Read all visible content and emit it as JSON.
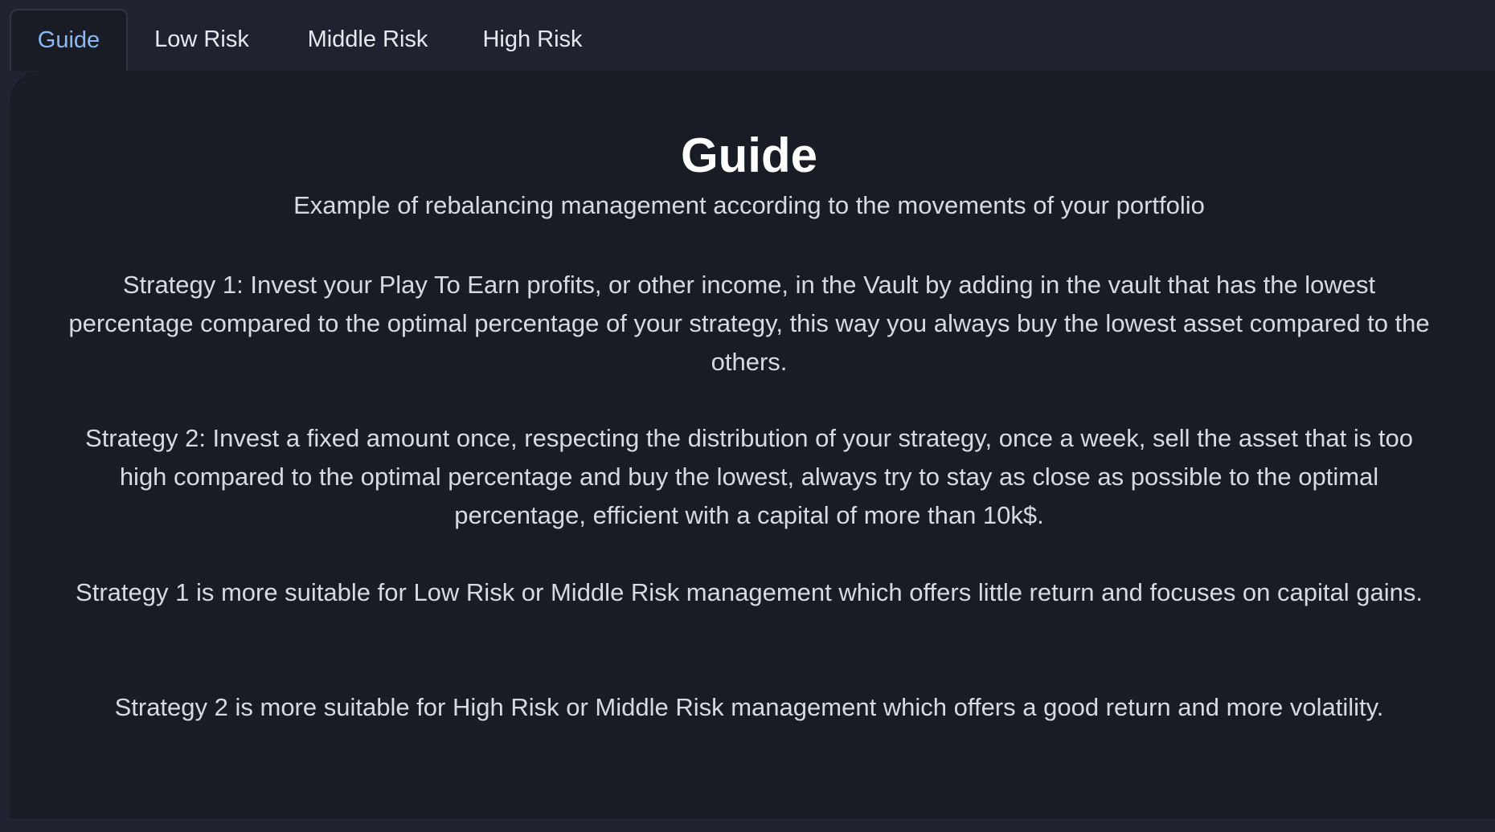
{
  "tabs": [
    {
      "label": "Guide",
      "active": true
    },
    {
      "label": "Low Risk",
      "active": false
    },
    {
      "label": "Middle Risk",
      "active": false
    },
    {
      "label": "High Risk",
      "active": false
    }
  ],
  "guide": {
    "title": "Guide",
    "subtitle": "Example of rebalancing management according to the movements of your portfolio",
    "paragraphs": [
      "Strategy 1: Invest your Play To Earn profits, or other income, in the Vault by adding in the vault that has the lowest percentage compared to the optimal percentage of your strategy, this way you always buy the lowest asset compared to the others.",
      "Strategy 2: Invest a fixed amount once, respecting the distribution of your strategy, once a week, sell the asset that is too high compared to the optimal percentage and buy the lowest, always try to stay as close as possible to the optimal percentage, efficient with a capital of more than 10k$.",
      "Strategy 1 is more suitable for Low Risk or Middle Risk management which offers little return and focuses on capital gains.",
      "Strategy 2 is more suitable for High Risk or Middle Risk management which offers a good return and more volatility."
    ]
  },
  "colors": {
    "background": "#1f2330",
    "panel": "#191c25",
    "active_tab_text": "#8ab9f5",
    "text": "#d7dae2",
    "title": "#ffffff"
  }
}
